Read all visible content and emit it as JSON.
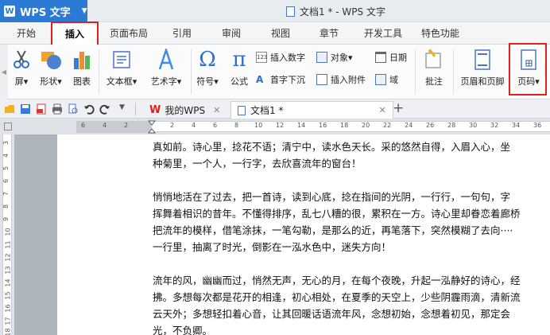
{
  "titlebar": {
    "app_name": "WPS 文字",
    "doc_title": "文档1 * - WPS 文字"
  },
  "menu": {
    "tabs": [
      {
        "label": "开始"
      },
      {
        "label": "插入"
      },
      {
        "label": "页面布局"
      },
      {
        "label": "引用"
      },
      {
        "label": "审阅"
      },
      {
        "label": "视图"
      },
      {
        "label": "章节"
      },
      {
        "label": "开发工具"
      },
      {
        "label": "特色功能"
      }
    ],
    "active": "插入"
  },
  "ribbon": {
    "screenshot": "屏▾",
    "shapes": "形状▾",
    "chart": "图表",
    "textbox": "文本框▾",
    "wordart": "艺术字▾",
    "symbol": "符号▾",
    "formula": "公式",
    "insert_number": "插入数字",
    "object": "对象▾",
    "date": "日期",
    "drop_cap": "首字下沉",
    "attachment": "插入附件",
    "field": "域",
    "comment": "批注",
    "header_footer": "页眉和页脚",
    "page_number": "页码▾"
  },
  "doctabs": {
    "my_wps": "我的WPS",
    "doc": "文档1 *"
  },
  "ruler": {
    "h_numbers": [
      "6",
      "4",
      "2",
      "2",
      "4",
      "6",
      "8",
      "10",
      "12",
      "14",
      "16",
      "18",
      "20",
      "22",
      "24",
      "26",
      "28",
      "30",
      "32",
      "34",
      "36",
      "38"
    ],
    "v_numbers": [
      "3",
      "4",
      "5",
      "6",
      "7",
      "8",
      "9",
      "10",
      "11",
      "12",
      "13",
      "14",
      "15",
      "16",
      "17",
      "18"
    ]
  },
  "document": {
    "lines": [
      "真如前。诗心里，捻花不语；清宁中，读水色天长。采的悠然自得，入眉入心，坐",
      "种菊里，一个人，一行字，去欣喜流年的窗台！",
      "",
      "悄悄地活在了过去，把一首诗，读到心底，捻在指间的光阴，一行行，一句句，字",
      "挥舞着相识的昔年。不懂得排序，乱七八糟的很，累积在一方。诗心里却眷恋着廊桥",
      "把流年的模样，借笔涂抹，一笔勾勒，是那么的近，再笔落下，突然模糊了去向····",
      "一行里，抽离了时光，倒影在一泓水色中，迷失方向！",
      "",
      "流年的风，幽幽而过，悄然无声，无心的月，在每个夜晚，升起一泓静好的诗心，经",
      "拂。多想每次都是花开的相逢，初心相处，在夏季的天空上，少些阴霾雨滴，清新流",
      "云天外；多想轻扣着心音，让其回暖话语流年风，念想初始，念想着初见，那定会",
      "光，不负卿。"
    ]
  }
}
